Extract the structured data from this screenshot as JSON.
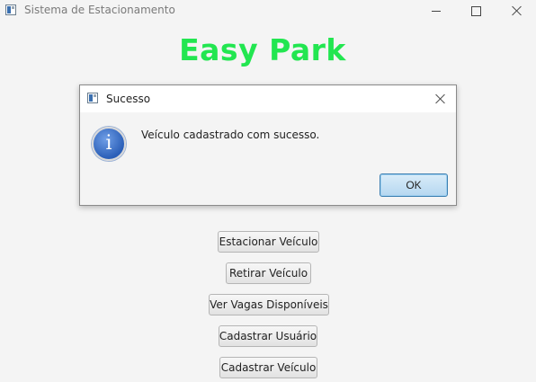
{
  "window": {
    "title": "Sistema de Estacionamento",
    "app_heading": "Easy Park"
  },
  "actions": [
    {
      "label": "Estacionar Veículo"
    },
    {
      "label": "Retirar Veículo"
    },
    {
      "label": "Ver Vagas Disponíveis"
    },
    {
      "label": "Cadastrar Usuário"
    },
    {
      "label": "Cadastrar Veículo"
    }
  ],
  "dialog": {
    "title": "Sucesso",
    "icon": "info-icon",
    "icon_glyph": "i",
    "message": "Veículo cadastrado com sucesso.",
    "ok_label": "OK"
  },
  "colors": {
    "heading": "#22e650",
    "ok_button": "#b5d7f0",
    "info_icon": "#2b5fb8"
  }
}
